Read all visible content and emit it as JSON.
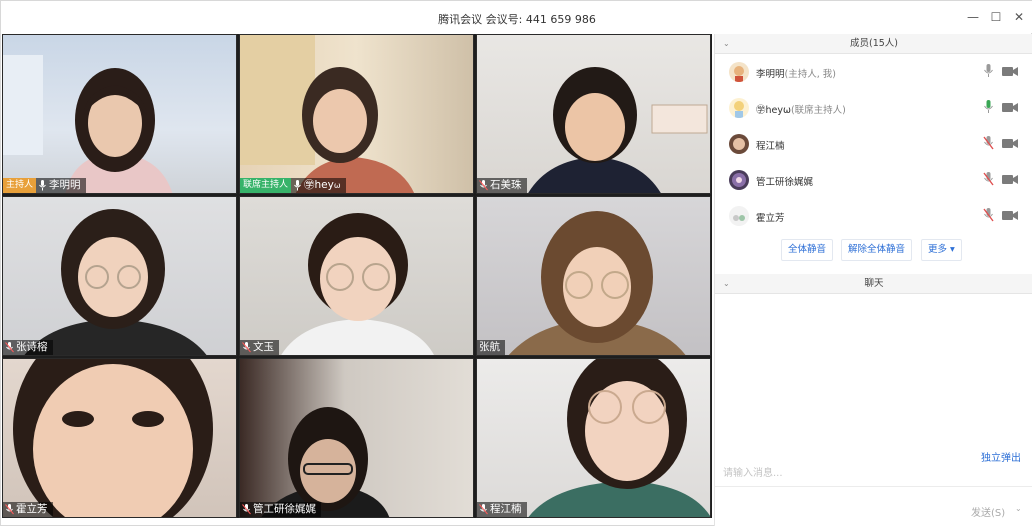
{
  "window": {
    "title": "腾讯会议  会议号: 441 659 986",
    "controls": {
      "minimize": "—",
      "maximize": "☐",
      "close": "✕"
    }
  },
  "video_tiles": [
    {
      "name": "李明明",
      "tag": "主持人",
      "tag_type": "host"
    },
    {
      "name": "hey",
      "prefix": "㊫",
      "suffix": "ω",
      "tag": "联席主持人",
      "tag_type": "cohost"
    },
    {
      "name": "石美珠"
    },
    {
      "name": "张诗榕"
    },
    {
      "name": "文玉"
    },
    {
      "name": "张航"
    },
    {
      "name": "霍立芳"
    },
    {
      "name": "管工研徐娓娓"
    },
    {
      "name": "程江楠"
    }
  ],
  "members": {
    "header": "成员(15人)",
    "list": [
      {
        "name": "李明明",
        "role": "(主持人, 我)",
        "mic": "on"
      },
      {
        "name": "㊫heyω",
        "role": "(联席主持人)",
        "mic": "on"
      },
      {
        "name": "程江楠",
        "role": "",
        "mic": "muted"
      },
      {
        "name": "管工研徐娓娓",
        "role": "",
        "mic": "muted"
      },
      {
        "name": "霍立芳",
        "role": "",
        "mic": "muted"
      }
    ],
    "actions": {
      "mute_all": "全体静音",
      "unmute_all": "解除全体静音",
      "more": "更多 ▾"
    }
  },
  "chat": {
    "header": "聊天",
    "popout": "独立弹出",
    "placeholder": "请输入消息...",
    "send": "发送(S)",
    "send_menu": "⌄"
  },
  "colors": {
    "host_tag": "#e8a03a",
    "cohost_tag": "#37b36a",
    "link_blue": "#2d6fd6",
    "mic_on": "#3aa655",
    "mic_muted": "#e05050"
  }
}
